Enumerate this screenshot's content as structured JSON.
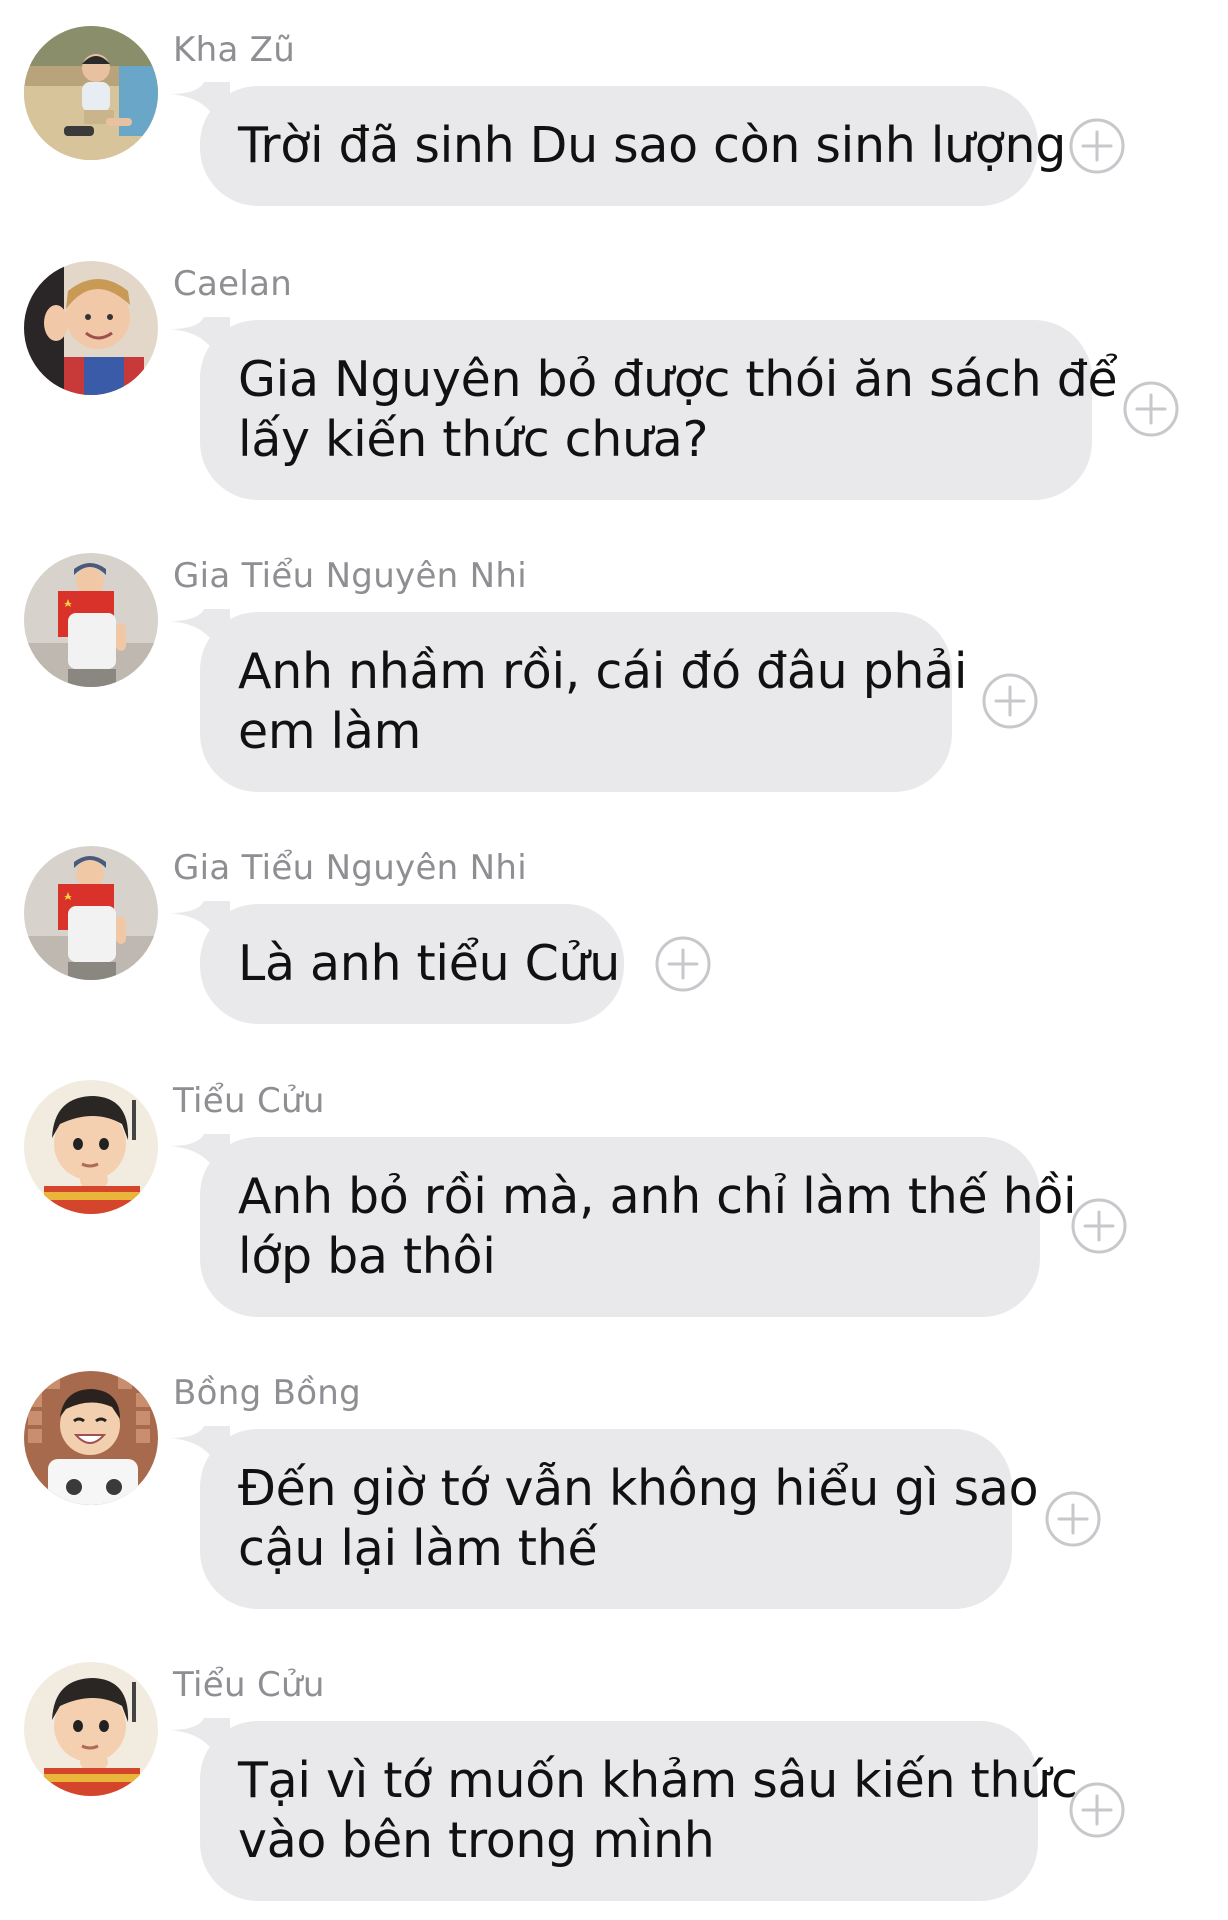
{
  "messages": [
    {
      "sender": "Kha Zũ",
      "avatar": "boy-sitting-pool-avatar",
      "lines": [
        "Trời đã sinh Du sao còn sinh lượng"
      ]
    },
    {
      "sender": "Caelan",
      "avatar": "blond-boy-waving-avatar",
      "lines": [
        "Gia Nguyên bỏ được thói ăn sách để",
        "lấy kiến thức chưa?"
      ]
    },
    {
      "sender": "Gia Tiểu Nguyên Nhi",
      "avatar": "boy-with-red-flag-avatar",
      "lines": [
        "Anh nhầm rồi, cái đó đâu phải",
        "em làm"
      ]
    },
    {
      "sender": "Gia Tiểu Nguyên Nhi",
      "avatar": "boy-with-red-flag-avatar",
      "lines": [
        "Là anh tiểu Cửu"
      ]
    },
    {
      "sender": "Tiểu Cửu",
      "avatar": "boy-hand-on-chin-avatar",
      "lines": [
        "Anh bỏ rồi mà, anh chỉ làm thế hồi",
        "lớp ba thôi"
      ]
    },
    {
      "sender": "Bồng Bồng",
      "avatar": "smiling-boy-tiles-avatar",
      "lines": [
        "Đến giờ tớ vẫn không hiểu gì sao",
        "cậu lại làm thế"
      ]
    },
    {
      "sender": "Tiểu Cửu",
      "avatar": "boy-hand-on-chin-avatar",
      "lines": [
        "Tại vì tớ muốn khảm sâu kiến thức",
        "vào bên trong mình"
      ]
    }
  ],
  "react_icon": "add-reaction-icon",
  "colors": {
    "bubble": "#e9e9eb",
    "sender_text": "#8e8e93",
    "message_text": "#111111",
    "react_icon": "#c7c7cc"
  }
}
